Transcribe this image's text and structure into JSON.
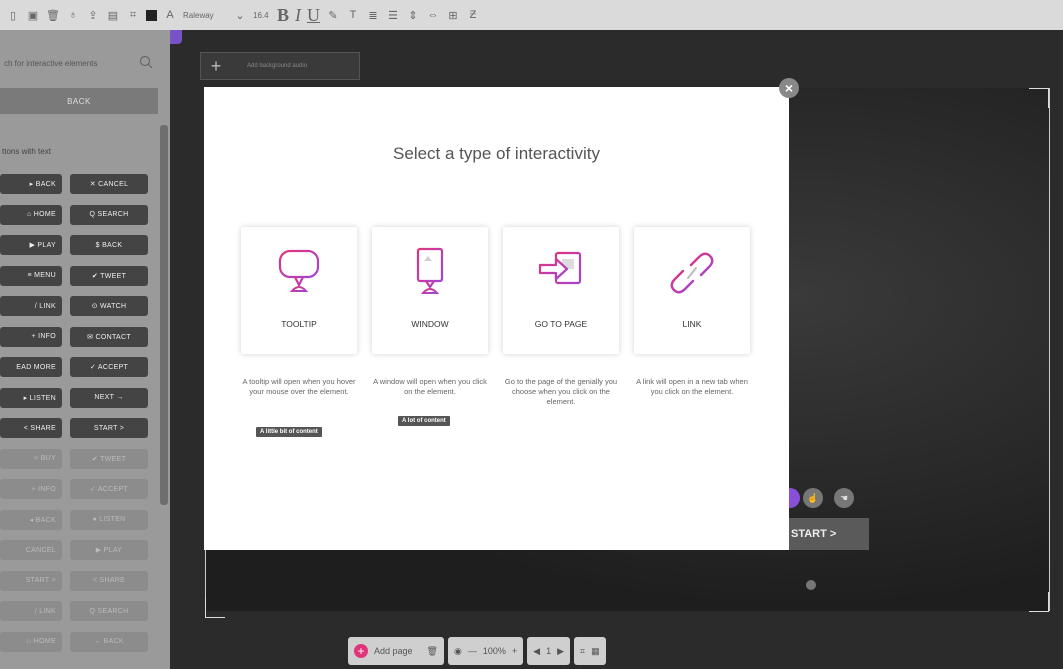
{
  "toolbar": {
    "font": "Raleway",
    "font_size": "16.4",
    "bold": "B",
    "italic": "I",
    "underline": "U",
    "icons": [
      "copy-icon",
      "frame-icon",
      "trash-icon",
      "layer-icon",
      "upload-icon",
      "bookmark-icon",
      "grid-icon",
      "black-square-icon",
      "text-icon",
      "bold-icon",
      "italic-icon",
      "underline-icon",
      "pen-icon",
      "font-size-icon",
      "align-icon",
      "list-icon",
      "line-height-icon",
      "spacing-icon"
    ]
  },
  "sidebar": {
    "search_placeholder": "ch for interactive elements",
    "back_label": "BACK",
    "heading": "ttons with text",
    "buttons_col1": [
      "▸ BACK",
      "⌂ HOME",
      "▶ PLAY",
      "≡ MENU",
      "/ LINK",
      "+ INFO",
      "EAD MORE",
      "▸ LISTEN",
      "< SHARE",
      "≈ BUY",
      "+ INFO",
      "◂ BACK",
      "CANCEL",
      "START >",
      "/ LINK",
      "⌂ HOME"
    ],
    "buttons_col2": [
      "✕ CANCEL",
      "Q SEARCH",
      "$ BACK",
      "✔ TWEET",
      "⊙ WATCH",
      "✉ CONTACT",
      "✓ ACCEPT",
      "NEXT →",
      "START >",
      "✔ TWEET",
      "✓ ACCEPT",
      "● LISTEN",
      "▶ PLAY",
      "< SHARE",
      "Q SEARCH",
      "← BACK"
    ]
  },
  "canvas": {
    "page_strip_label": "Add background audio",
    "start_button": "START >"
  },
  "bottom_bar": {
    "add_page": "Add page",
    "zoom_minus": "—",
    "zoom": "100%",
    "zoom_plus": "+",
    "page_number": "1"
  },
  "modal": {
    "title": "Select a type of interactivity",
    "close": "×",
    "options": [
      {
        "label": "TOOLTIP",
        "description": "A tooltip will open when you hover your mouse over the element.",
        "tag": "A little bit of content"
      },
      {
        "label": "WINDOW",
        "description": "A window will open when you click on the element.",
        "tag": "A lot of content"
      },
      {
        "label": "GO TO PAGE",
        "description": "Go to the page of the genially you choose when you click on the element.",
        "tag": ""
      },
      {
        "label": "LINK",
        "description": "A link will open in a new tab when you click on the element.",
        "tag": ""
      }
    ]
  },
  "colors": {
    "accent": "#e0357a",
    "accent_purple": "#a244d8"
  }
}
